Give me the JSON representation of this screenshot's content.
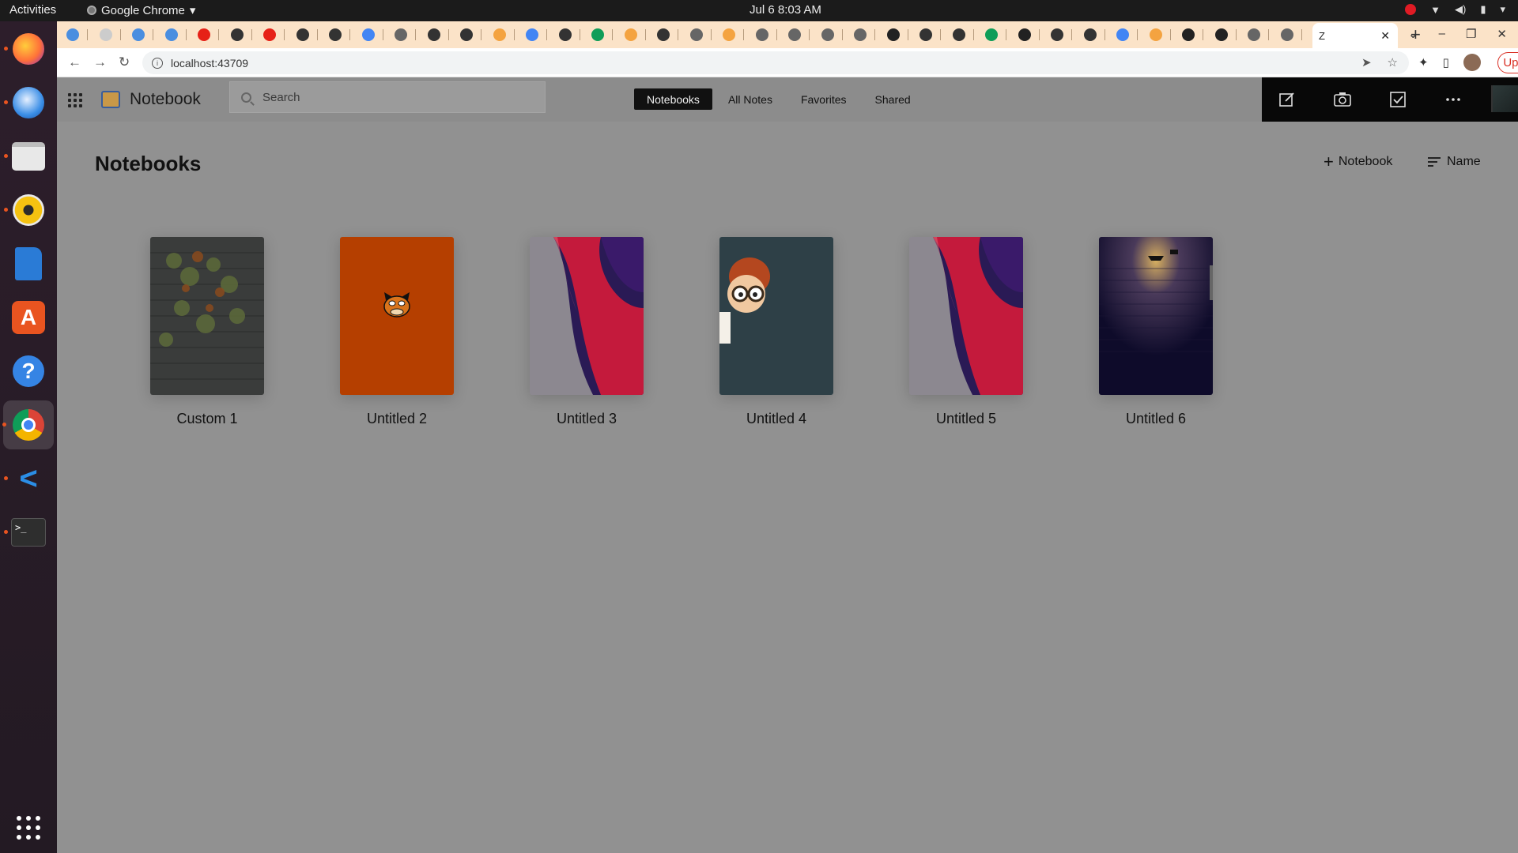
{
  "system": {
    "activities": "Activities",
    "app_name": "Google Chrome",
    "clock": "Jul 6  8:03 AM"
  },
  "browser": {
    "active_tab_label": "Z",
    "address": "localhost:43709",
    "update_label": "Update"
  },
  "app": {
    "title": "Notebook",
    "search_placeholder": "Search",
    "tabs": [
      "Notebooks",
      "All Notes",
      "Favorites",
      "Shared"
    ],
    "active_tab": "Notebooks"
  },
  "main": {
    "page_title": "Notebooks",
    "new_notebook_label": "Notebook",
    "sort_label": "Name",
    "notebooks": [
      {
        "title": "Custom 1",
        "cover": "ivy-brick-wall"
      },
      {
        "title": "Untitled 2",
        "cover": "orange-cat-face"
      },
      {
        "title": "Untitled 3",
        "cover": "abstract-red-wave"
      },
      {
        "title": "Untitled 4",
        "cover": "cartoon-boy-glasses"
      },
      {
        "title": "Untitled 5",
        "cover": "abstract-red-wave"
      },
      {
        "title": "Untitled 6",
        "cover": "lamp-brick-wall"
      }
    ]
  }
}
